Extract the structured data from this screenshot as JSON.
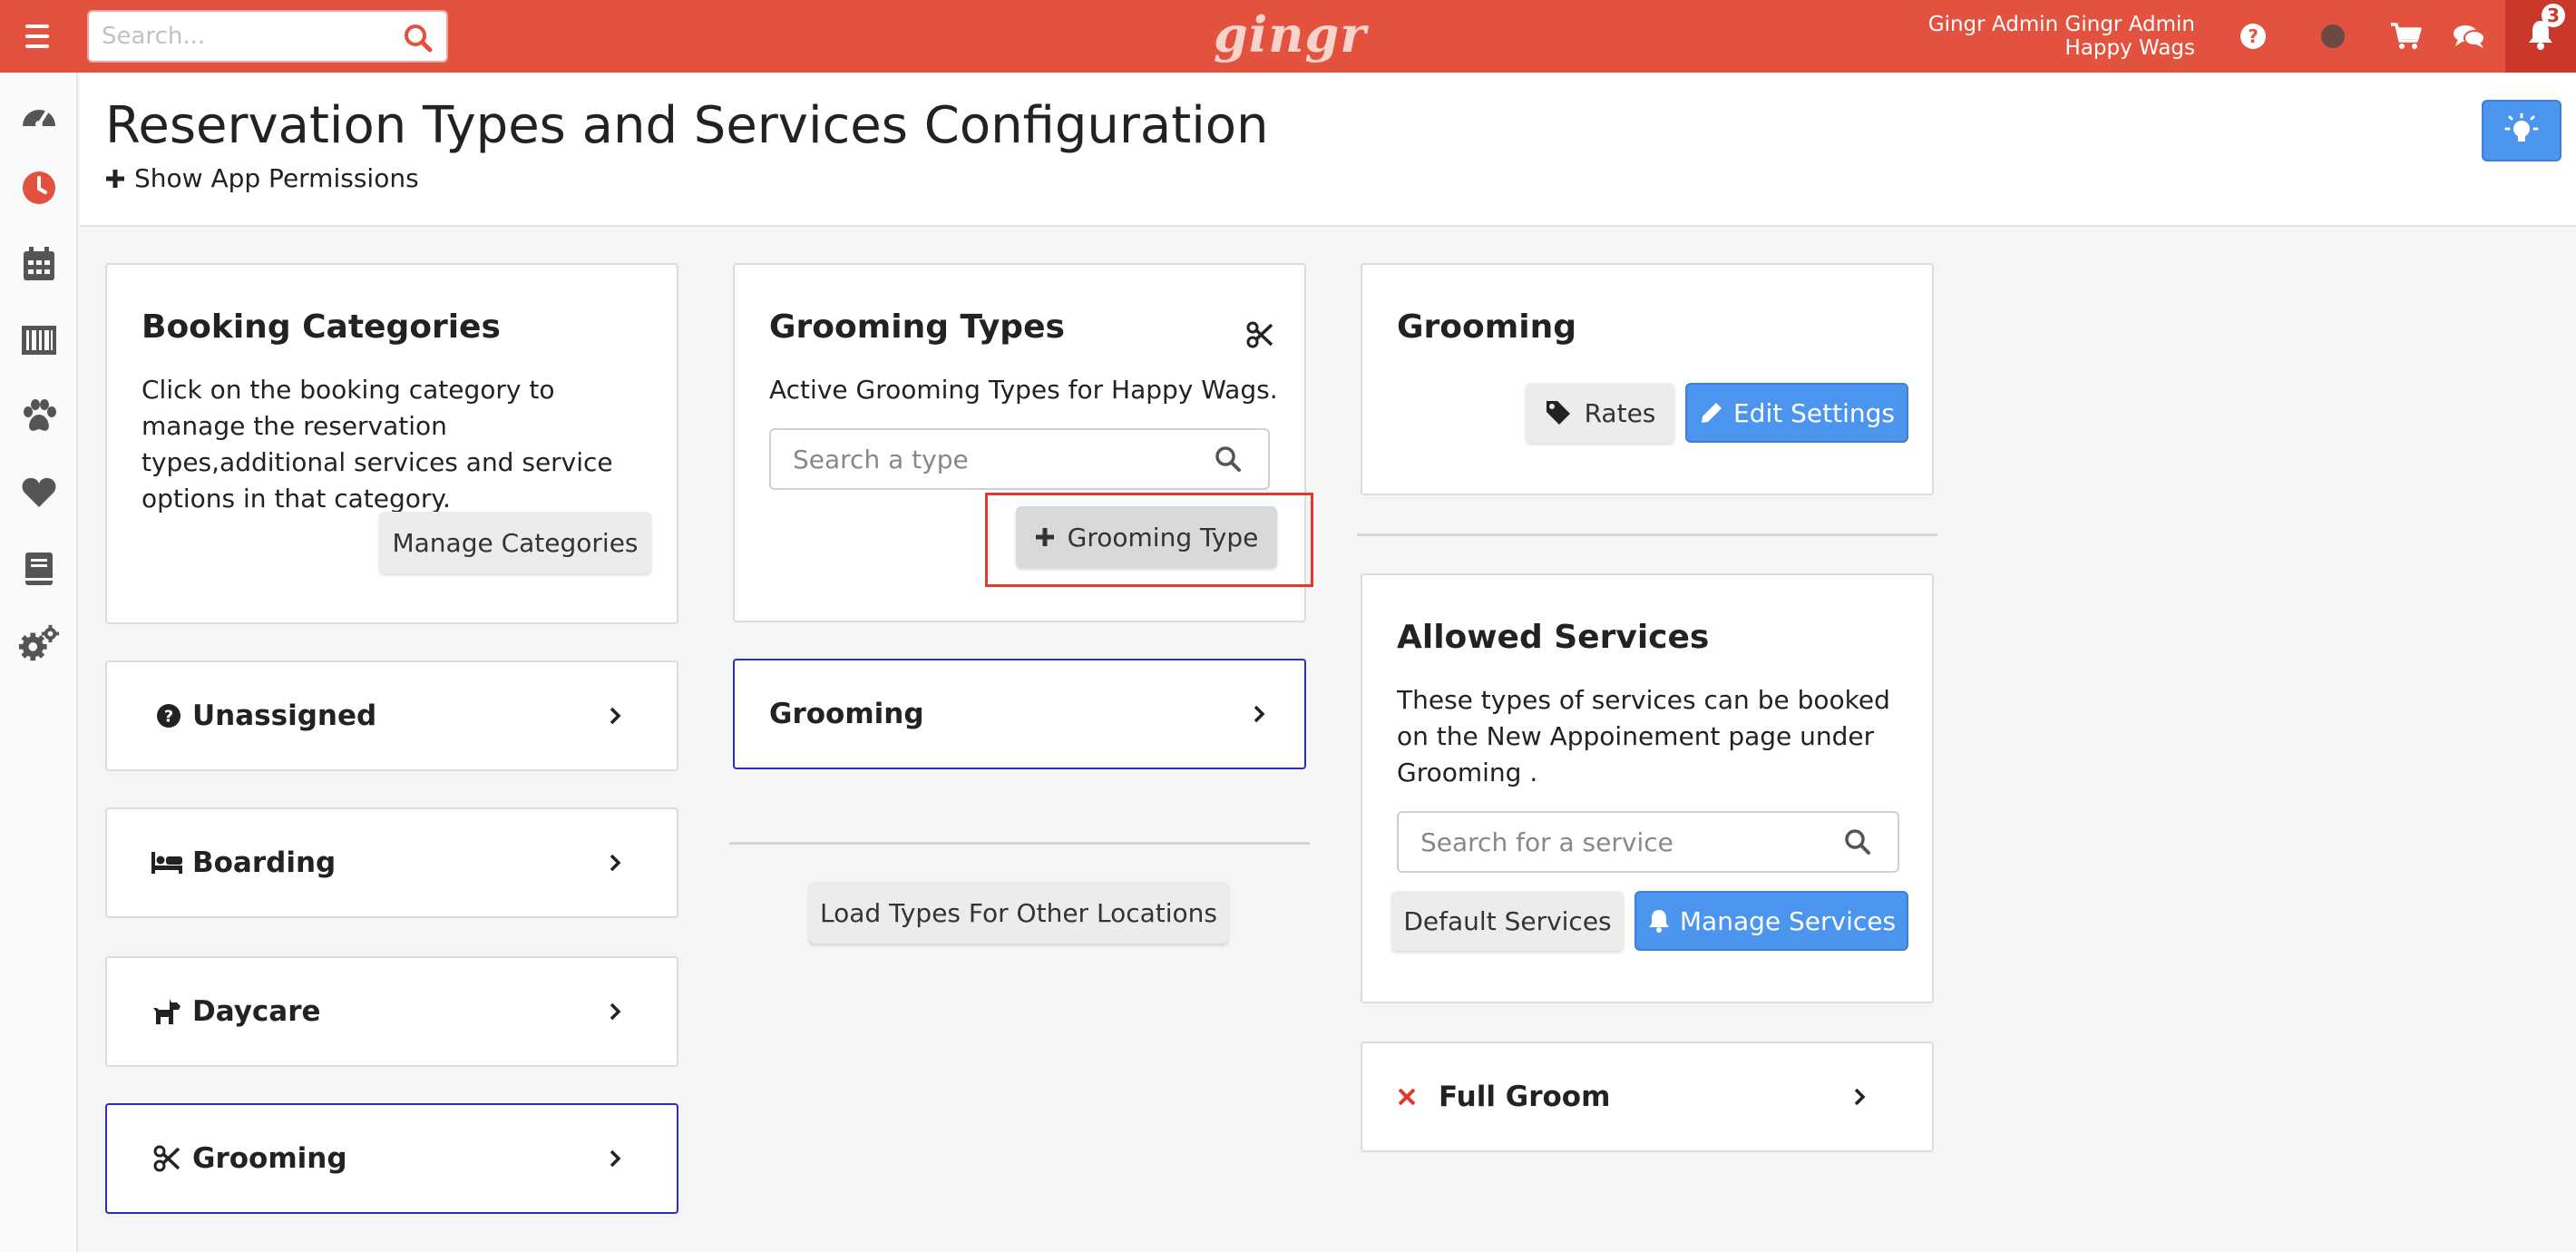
{
  "topbar": {
    "search_placeholder": "Search...",
    "logo": "gingr",
    "user_line1": "Gingr Admin Gingr Admin",
    "user_line2": "Happy Wags",
    "notification_count": "3",
    "brand_color": "#e2523f"
  },
  "header": {
    "title": "Reservation Types and Services Configuration",
    "permissions_link": "Show App Permissions"
  },
  "booking_categories": {
    "title": "Booking Categories",
    "description": "Click on the booking category to manage the reservation types,additional services and service options in that category.",
    "manage_button": "Manage Categories",
    "items": [
      {
        "label": "Unassigned",
        "icon": "question-circle-icon"
      },
      {
        "label": "Boarding",
        "icon": "bed-icon"
      },
      {
        "label": "Daycare",
        "icon": "dog-icon"
      },
      {
        "label": "Grooming",
        "icon": "scissors-icon",
        "selected": true
      }
    ]
  },
  "grooming_types": {
    "title": "Grooming Types",
    "subtitle": "Active Grooming Types for Happy Wags.",
    "search_placeholder": "Search a type",
    "add_button": "Grooming Type",
    "items": [
      {
        "label": "Grooming",
        "selected": true
      }
    ],
    "load_button": "Load Types For Other Locations"
  },
  "grooming_settings": {
    "title": "Grooming",
    "rates_button": "Rates",
    "edit_button": "Edit Settings"
  },
  "allowed_services": {
    "title": "Allowed Services",
    "description": "These types of services can be booked on the New Appoinement page under Grooming .",
    "search_placeholder": "Search for a service",
    "default_button": "Default Services",
    "manage_button": "Manage Services",
    "items": [
      {
        "label": "Full Groom",
        "status": "inactive"
      }
    ]
  }
}
